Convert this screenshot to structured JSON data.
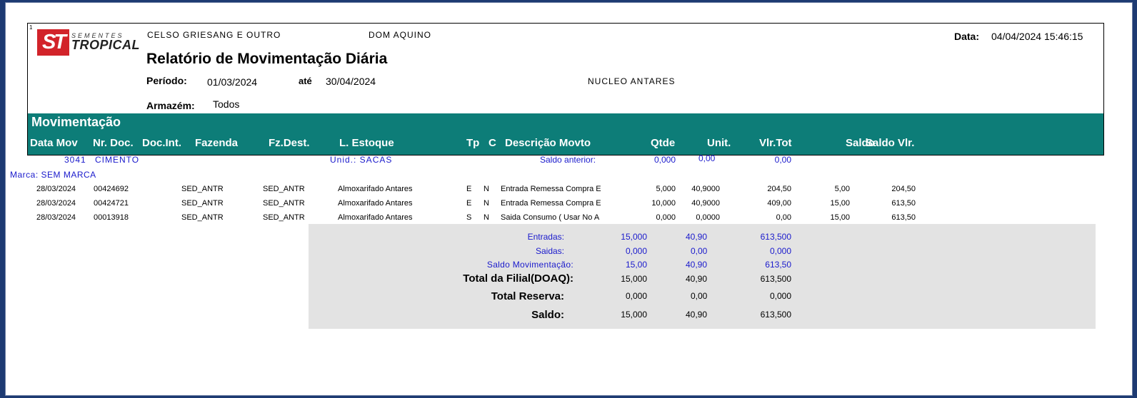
{
  "header": {
    "corner_number": "1",
    "logo": {
      "brand_small": "SEMENTES",
      "brand_main": "TROPICAL",
      "mark": "ST"
    },
    "company": "CELSO GRIESANG E OUTRO",
    "location": "DOM AQUINO",
    "date_label": "Data:",
    "date_value": "04/04/2024 15:46:15",
    "title": "Relatório de Movimentação Diária",
    "period_label": "Período:",
    "period_start": "01/03/2024",
    "period_until_label": "até",
    "period_end": "30/04/2024",
    "nucleo": "NUCLEO ANTARES",
    "warehouse_label": "Armazém:",
    "warehouse_value": "Todos"
  },
  "section_title": "Movimentação",
  "columns": [
    "Data Mov",
    "Nr. Doc.",
    "Doc.Int.",
    "Fazenda",
    "Fz.Dest.",
    "L. Estoque",
    "Tp",
    "C",
    "Descrição Movto",
    "Qtde",
    "Unit.",
    "Vlr.Tot",
    "Saldo",
    "Saldo Vlr."
  ],
  "product": {
    "code": "3041",
    "name": "CIMENTO",
    "unit_label": "Unid.: SACAS",
    "prev_balance_label": "Saldo anterior:",
    "prev_qty": "0,000",
    "prev_unit": "0,00",
    "prev_total": "0,00",
    "brand": "Marca: SEM MARCA"
  },
  "rows": [
    {
      "date": "28/03/2024",
      "doc": "00424692",
      "farm": "SED_ANTR",
      "dest": "SED_ANTR",
      "stock": "Almoxarifado Antares",
      "tp": "E",
      "c": "N",
      "desc": "Entrada Remessa Compra E",
      "qty": "5,000",
      "unit": "40,9000",
      "total": "204,50",
      "balance": "5,00",
      "balance_value": "204,50"
    },
    {
      "date": "28/03/2024",
      "doc": "00424721",
      "farm": "SED_ANTR",
      "dest": "SED_ANTR",
      "stock": "Almoxarifado Antares",
      "tp": "E",
      "c": "N",
      "desc": "Entrada Remessa Compra E",
      "qty": "10,000",
      "unit": "40,9000",
      "total": "409,00",
      "balance": "15,00",
      "balance_value": "613,50"
    },
    {
      "date": "28/03/2024",
      "doc": "00013918",
      "farm": "SED_ANTR",
      "dest": "SED_ANTR",
      "stock": "Almoxarifado Antares",
      "tp": "S",
      "c": "N",
      "desc": "Saida Consumo ( Usar No A",
      "qty": "0,000",
      "unit": "0,0000",
      "total": "0,00",
      "balance": "15,00",
      "balance_value": "613,50"
    }
  ],
  "summary": [
    {
      "label": "Entradas:",
      "qty": "15,000",
      "unit": "40,90",
      "total": "613,500"
    },
    {
      "label": "Saidas:",
      "qty": "0,000",
      "unit": "0,00",
      "total": "0,000"
    },
    {
      "label": "Saldo Movimentação:",
      "qty": "15,00",
      "unit": "40,90",
      "total": "613,50"
    },
    {
      "label": "Total da Filial(DOAQ):",
      "qty": "15,000",
      "unit": "40,90",
      "total": "613,500"
    },
    {
      "label": "Total Reserva:",
      "qty": "0,000",
      "unit": "0,00",
      "total": "0,000"
    },
    {
      "label": "Saldo:",
      "qty": "15,000",
      "unit": "40,90",
      "total": "613,500"
    }
  ],
  "colors": {
    "band": "#0d7d78",
    "blue_text": "#1a1acc",
    "summary_bg": "#e3e3e3",
    "logo_red": "#d2232a"
  }
}
